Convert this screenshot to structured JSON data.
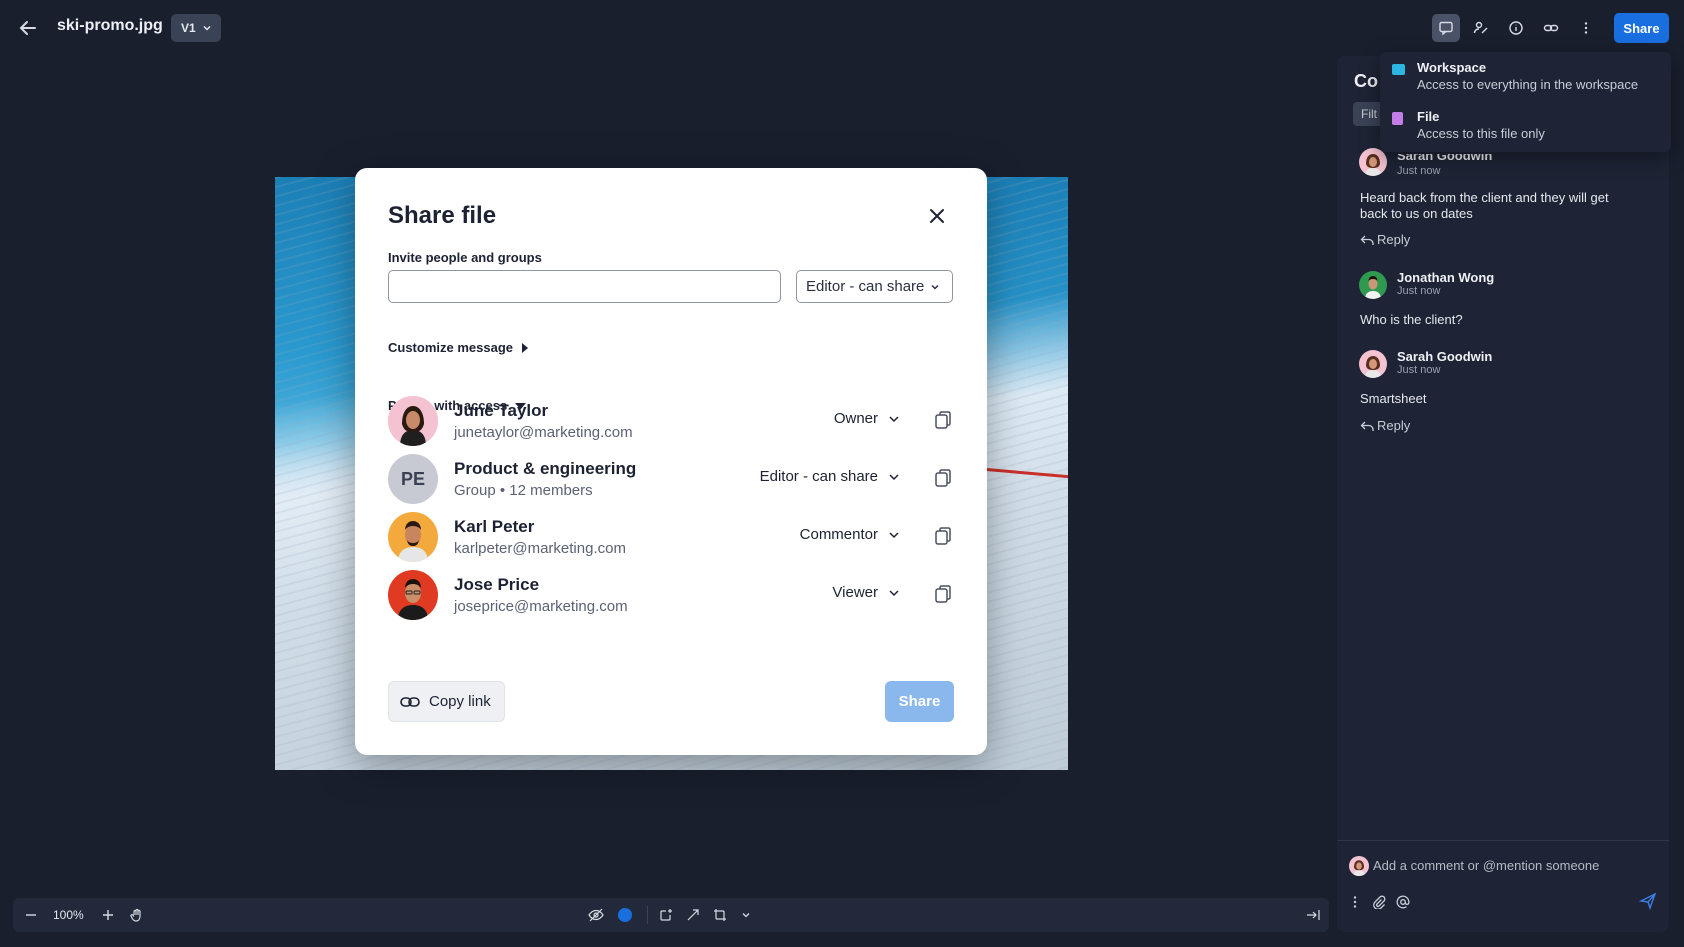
{
  "header": {
    "filename": "ski-promo.jpg",
    "version": "V1",
    "share_label": "Share"
  },
  "icons": {
    "back": "arrow-left-icon",
    "comments": "comment-icon",
    "people": "people-icon",
    "info": "info-icon",
    "link": "link-icon",
    "more": "more-vertical-icon"
  },
  "share_modal": {
    "title": "Share file",
    "invite_label": "Invite people and groups",
    "invite_value": "",
    "role_select": "Editor - can share",
    "customize_label": "Customize message",
    "people_label": "People with access",
    "people": [
      {
        "name": "June Taylor",
        "sub": "junetaylor@marketing.com",
        "role": "Owner",
        "initials": ""
      },
      {
        "name": "Product & engineering",
        "sub": "Group • 12 members",
        "role": "Editor - can share",
        "initials": "PE"
      },
      {
        "name": "Karl Peter",
        "sub": "karlpeter@marketing.com",
        "role": "Commentor",
        "initials": ""
      },
      {
        "name": "Jose Price",
        "sub": "joseprice@marketing.com",
        "role": "Viewer",
        "initials": ""
      }
    ],
    "copy_link_label": "Copy link",
    "share_label": "Share"
  },
  "dropdown": {
    "items": [
      {
        "title": "Workspace",
        "desc": "Access to everything in the workspace",
        "color": "#2cb5e0"
      },
      {
        "title": "File",
        "desc": "Access to this file only",
        "color": "#c47ee8"
      }
    ]
  },
  "comments_panel": {
    "title_partial": "Co",
    "filter_partial": "Filt",
    "comments": [
      {
        "author": "Sarah Goodwin",
        "time": "Just now",
        "text": "Heard back from the client and they will get back to us on dates",
        "reply": "Reply"
      },
      {
        "author": "Jonathan Wong",
        "time": "Just now",
        "text": "Who is the client?",
        "reply": ""
      },
      {
        "author": "Sarah Goodwin",
        "time": "Just now",
        "text": "Smartsheet",
        "reply": "Reply"
      }
    ],
    "input_placeholder": "Add a comment or @mention someone"
  },
  "bottom_bar": {
    "zoom": "100%"
  },
  "colors": {
    "accent": "#1a6fe0",
    "background": "#1a1f2e",
    "panel": "#1e2435"
  }
}
